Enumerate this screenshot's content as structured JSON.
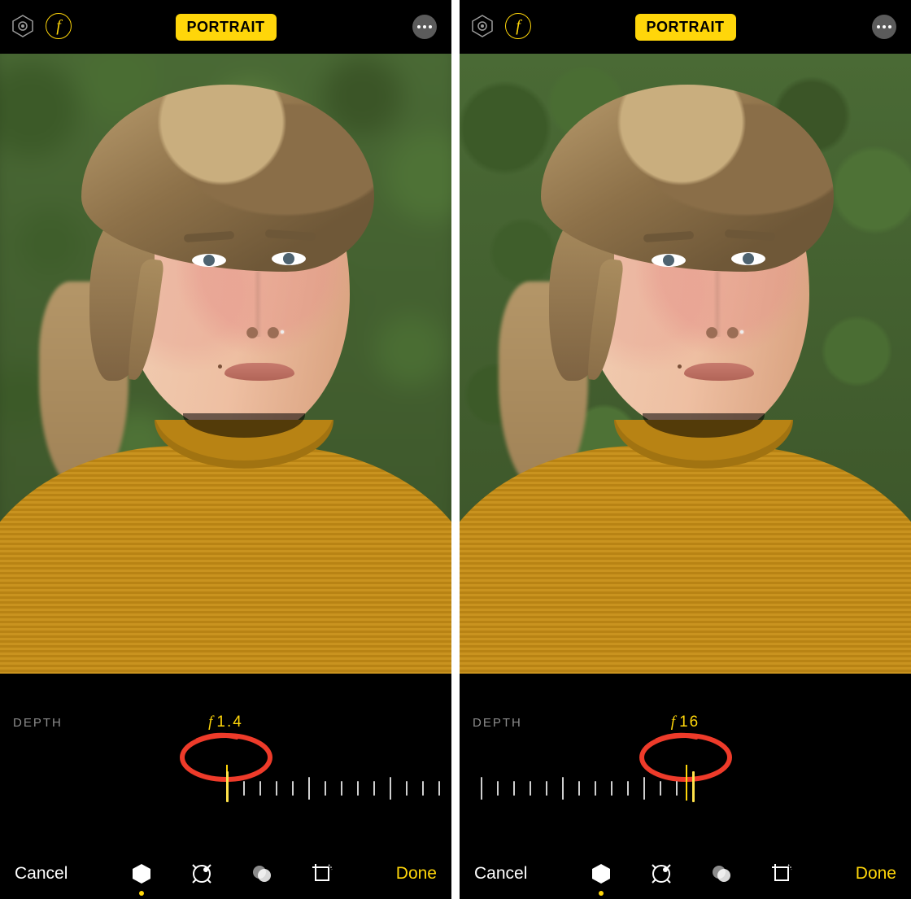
{
  "screens": [
    {
      "topbar": {
        "mode_label": "PORTRAIT",
        "f_icon_glyph": "f"
      },
      "depth": {
        "label": "DEPTH",
        "aperture_display": "1.4"
      },
      "toolbar": {
        "cancel": "Cancel",
        "done": "Done",
        "selected_tool": "lighting"
      },
      "photo": {
        "background_blur": true
      }
    },
    {
      "topbar": {
        "mode_label": "PORTRAIT",
        "f_icon_glyph": "f"
      },
      "depth": {
        "label": "DEPTH",
        "aperture_display": "16"
      },
      "toolbar": {
        "cancel": "Cancel",
        "done": "Done",
        "selected_tool": "lighting"
      },
      "photo": {
        "background_blur": false
      }
    }
  ],
  "annotation": {
    "color": "#ee3b2a"
  }
}
